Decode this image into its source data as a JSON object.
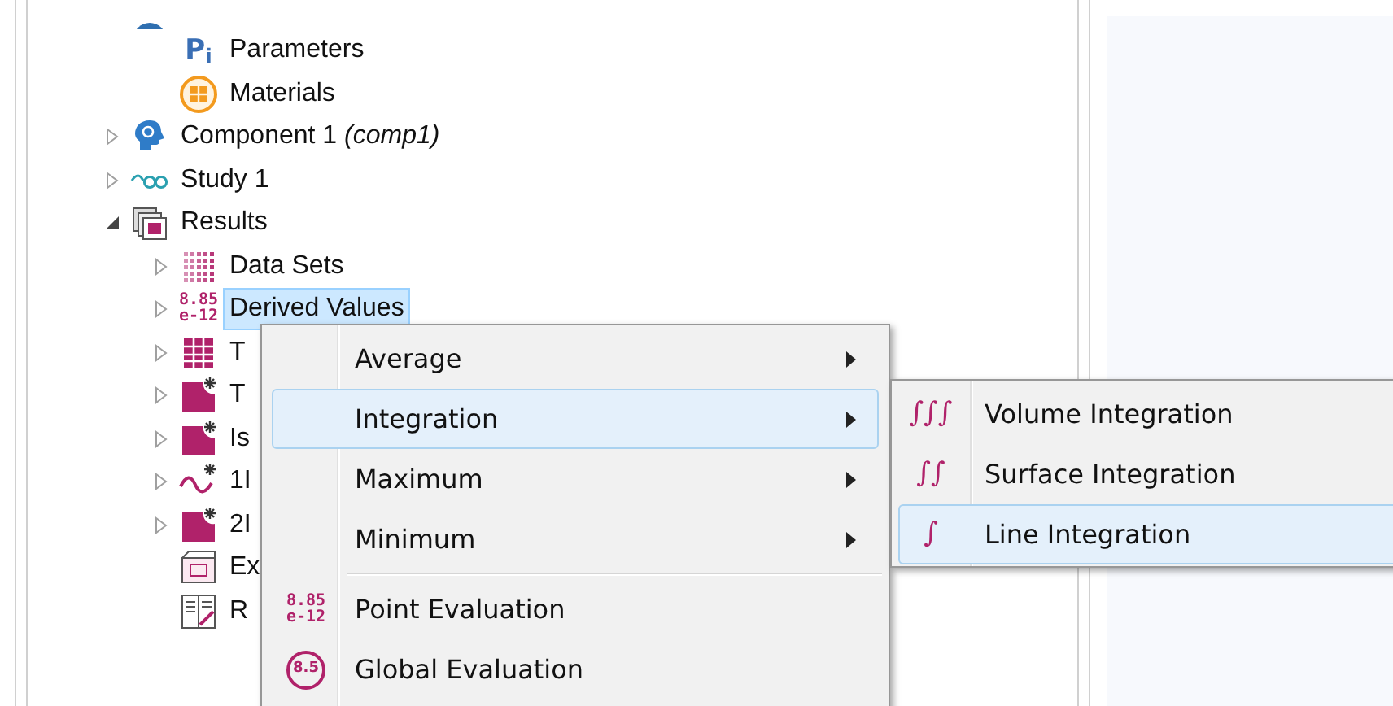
{
  "tree": {
    "items": [
      {
        "kind": "globe",
        "children": [
          {
            "label": "Parameters",
            "kind": "pi",
            "symbol": "P$_{i}$",
            "selected": false
          },
          {
            "label": "Materials",
            "kind": "materials",
            "selected": false
          }
        ]
      },
      {
        "label": "Component 1",
        "suffix": "(comp1)",
        "kind": "component",
        "selected": false,
        "expanded": false
      },
      {
        "label": "Study 1",
        "kind": "study",
        "selected": false,
        "expanded": false
      },
      {
        "label": "Results",
        "kind": "results",
        "selected": false,
        "expanded": true,
        "children": [
          {
            "label": "Data Sets",
            "kind": "datasets",
            "selected": false,
            "expanded": false
          },
          {
            "label": "Derived Values",
            "kind": "derived",
            "badge": [
              "8.85",
              "e-12"
            ],
            "selected": true,
            "expanded": false
          },
          {
            "label": "T",
            "kind": "table",
            "selected": false,
            "expanded": false
          },
          {
            "label": "T",
            "kind": "plot",
            "selected": false,
            "expanded": false
          },
          {
            "label": "Is",
            "kind": "plot",
            "selected": false,
            "expanded": false
          },
          {
            "label": "1I",
            "kind": "wave",
            "selected": false,
            "expanded": false
          },
          {
            "label": "2I",
            "kind": "plot",
            "selected": false,
            "expanded": false
          },
          {
            "label": "Ex",
            "kind": "export",
            "selected": false
          },
          {
            "label": "R",
            "kind": "report",
            "selected": false
          }
        ]
      }
    ]
  },
  "context_menu": {
    "items": [
      {
        "kind": "item",
        "label": "Average",
        "submenu": true,
        "selected": false
      },
      {
        "kind": "item",
        "label": "Integration",
        "submenu": true,
        "selected": true
      },
      {
        "kind": "item",
        "label": "Maximum",
        "submenu": true,
        "selected": false
      },
      {
        "kind": "item",
        "label": "Minimum",
        "submenu": true,
        "selected": false
      },
      {
        "kind": "separator"
      },
      {
        "kind": "item",
        "label": "Point Evaluation",
        "badge": [
          "8.85",
          "e-12"
        ],
        "submenu": false,
        "selected": false
      },
      {
        "kind": "item",
        "label": "Global Evaluation",
        "circle": "8.5",
        "submenu": false,
        "selected": false
      }
    ]
  },
  "submenu": {
    "items": [
      {
        "label": "Volume Integration",
        "symbol": "∫∫∫",
        "selected": false
      },
      {
        "label": "Surface Integration",
        "symbol": "∫∫",
        "selected": false
      },
      {
        "label": "Line Integration",
        "symbol": "∫",
        "selected": true
      }
    ]
  }
}
